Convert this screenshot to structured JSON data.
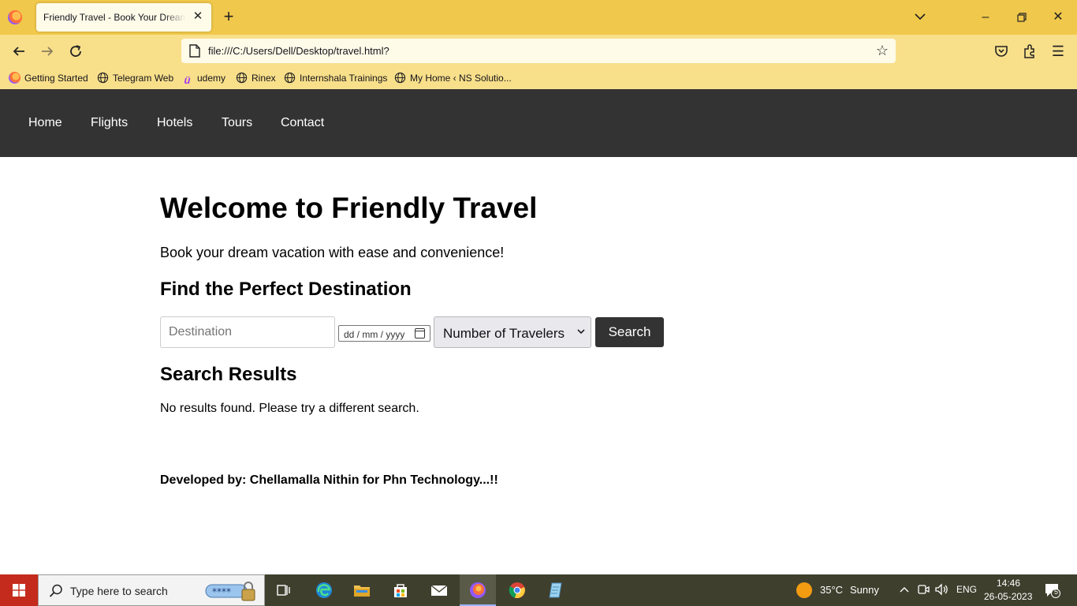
{
  "browser": {
    "tab_title": "Friendly Travel - Book Your Dream Vacation",
    "url": "file:///C:/Users/Dell/Desktop/travel.html?",
    "bookmarks": [
      {
        "label": "Getting Started",
        "icon": "firefox-icon"
      },
      {
        "label": "Telegram Web",
        "icon": "globe-icon"
      },
      {
        "label": "udemy",
        "icon": "udemy-icon"
      },
      {
        "label": "Rinex",
        "icon": "globe-icon"
      },
      {
        "label": "Internshala Trainings",
        "icon": "globe-icon"
      },
      {
        "label": "My Home ‹ NS Solutio...",
        "icon": "globe-icon"
      }
    ],
    "chrome_color": "#f0c84b",
    "toolbar_color": "#f8df8a"
  },
  "site": {
    "nav": [
      "Home",
      "Flights",
      "Hotels",
      "Tours",
      "Contact"
    ],
    "title": "Welcome to Friendly Travel",
    "tagline": "Book your dream vacation with ease and convenience!",
    "find_heading": "Find the Perfect Destination",
    "search_form": {
      "destination_placeholder": "Destination",
      "date_placeholder": "dd / mm / yyyy",
      "travelers_selected": "Number of Travelers",
      "search_label": "Search"
    },
    "results_heading": "Search Results",
    "results_text": "No results found. Please try a different search.",
    "footer": "Developed by: Chellamalla Nithin for Phn Technology...!!",
    "nav_bg": "#333333"
  },
  "taskbar": {
    "search_placeholder": "Type here to search",
    "weather_temp": "35°C",
    "weather_text": "Sunny",
    "language": "ENG",
    "time": "14:46",
    "date": "26-05-2023",
    "notification_count": "5"
  }
}
